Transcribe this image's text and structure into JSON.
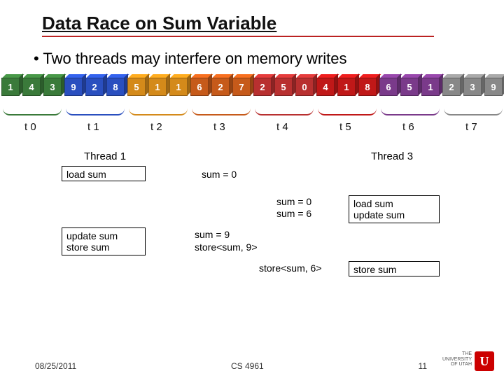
{
  "title": "Data Race on Sum Variable",
  "bullet": "• Two threads may interfere on memory writes",
  "cubes": [
    {
      "v": "1",
      "c": "#3a7a3a"
    },
    {
      "v": "4",
      "c": "#3a7a3a"
    },
    {
      "v": "3",
      "c": "#3a7a3a"
    },
    {
      "v": "9",
      "c": "#2a4fbf"
    },
    {
      "v": "2",
      "c": "#2a4fbf"
    },
    {
      "v": "8",
      "c": "#2a4fbf"
    },
    {
      "v": "5",
      "c": "#d48a1a"
    },
    {
      "v": "1",
      "c": "#d48a1a"
    },
    {
      "v": "1",
      "c": "#d48a1a"
    },
    {
      "v": "6",
      "c": "#c65a1a"
    },
    {
      "v": "2",
      "c": "#c65a1a"
    },
    {
      "v": "7",
      "c": "#c65a1a"
    },
    {
      "v": "2",
      "c": "#b83030"
    },
    {
      "v": "5",
      "c": "#b83030"
    },
    {
      "v": "0",
      "c": "#b83030"
    },
    {
      "v": "4",
      "c": "#c01818"
    },
    {
      "v": "1",
      "c": "#c01818"
    },
    {
      "v": "8",
      "c": "#c01818"
    },
    {
      "v": "6",
      "c": "#7a3a8a"
    },
    {
      "v": "5",
      "c": "#7a3a8a"
    },
    {
      "v": "1",
      "c": "#7a3a8a"
    },
    {
      "v": "2",
      "c": "#888"
    },
    {
      "v": "3",
      "c": "#888"
    },
    {
      "v": "9",
      "c": "#888"
    }
  ],
  "brace_colors": [
    "#3a7a3a",
    "#2a4fbf",
    "#d48a1a",
    "#c65a1a",
    "#b83030",
    "#c01818",
    "#7a3a8a",
    "#888"
  ],
  "t_labels": [
    "t 0",
    "t 1",
    "t 2",
    "t 3",
    "t 4",
    "t 5",
    "t 6",
    "t 7"
  ],
  "threads": {
    "t1_title": "Thread 1",
    "t3_title": "Thread 3",
    "t1_load": "load sum",
    "t1_update": "update sum\nstore sum",
    "t3_load_update": "load sum\nupdate sum",
    "t3_store": "store sum"
  },
  "mid": {
    "sum0": "sum = 0",
    "sum0b": "sum = 0",
    "sum6": "sum = 6",
    "sum9": "sum = 9",
    "store9": "store<sum, 9>",
    "store6": "store<sum, 6>"
  },
  "footer": {
    "date": "08/25/2011",
    "course": "CS 4961",
    "page": "11"
  },
  "logo": {
    "line1": "THE",
    "line2": "UNIVERSITY",
    "line3": "OF UTAH",
    "u": "U"
  },
  "chart_data": {
    "type": "table",
    "description": "24 array elements partitioned into 8 groups of 3 for threads t0..t7; diagram illustrates a data race updating shared variable 'sum' between Thread 1 and Thread 3",
    "groups": [
      {
        "thread": "t0",
        "color": "green",
        "values": [
          1,
          4,
          3
        ]
      },
      {
        "thread": "t1",
        "color": "blue",
        "values": [
          9,
          2,
          8
        ]
      },
      {
        "thread": "t2",
        "color": "amber",
        "values": [
          5,
          1,
          1
        ]
      },
      {
        "thread": "t3",
        "color": "orange",
        "values": [
          6,
          2,
          7
        ]
      },
      {
        "thread": "t4",
        "color": "brick",
        "values": [
          2,
          5,
          0
        ]
      },
      {
        "thread": "t5",
        "color": "red",
        "values": [
          4,
          1,
          8
        ]
      },
      {
        "thread": "t6",
        "color": "purple",
        "values": [
          6,
          5,
          1
        ]
      },
      {
        "thread": "t7",
        "color": "gray",
        "values": [
          2,
          3,
          9
        ]
      }
    ],
    "race_timeline": [
      {
        "actor": "Thread 1",
        "action": "load sum",
        "value": 0
      },
      {
        "actor": "Thread 3",
        "action": "load sum",
        "value": 0
      },
      {
        "actor": "Thread 3",
        "action": "update sum",
        "value": 6
      },
      {
        "actor": "Thread 1",
        "action": "update sum",
        "value": 9
      },
      {
        "actor": "Thread 1",
        "action": "store<sum, 9>"
      },
      {
        "actor": "Thread 3",
        "action": "store<sum, 6>"
      }
    ]
  }
}
